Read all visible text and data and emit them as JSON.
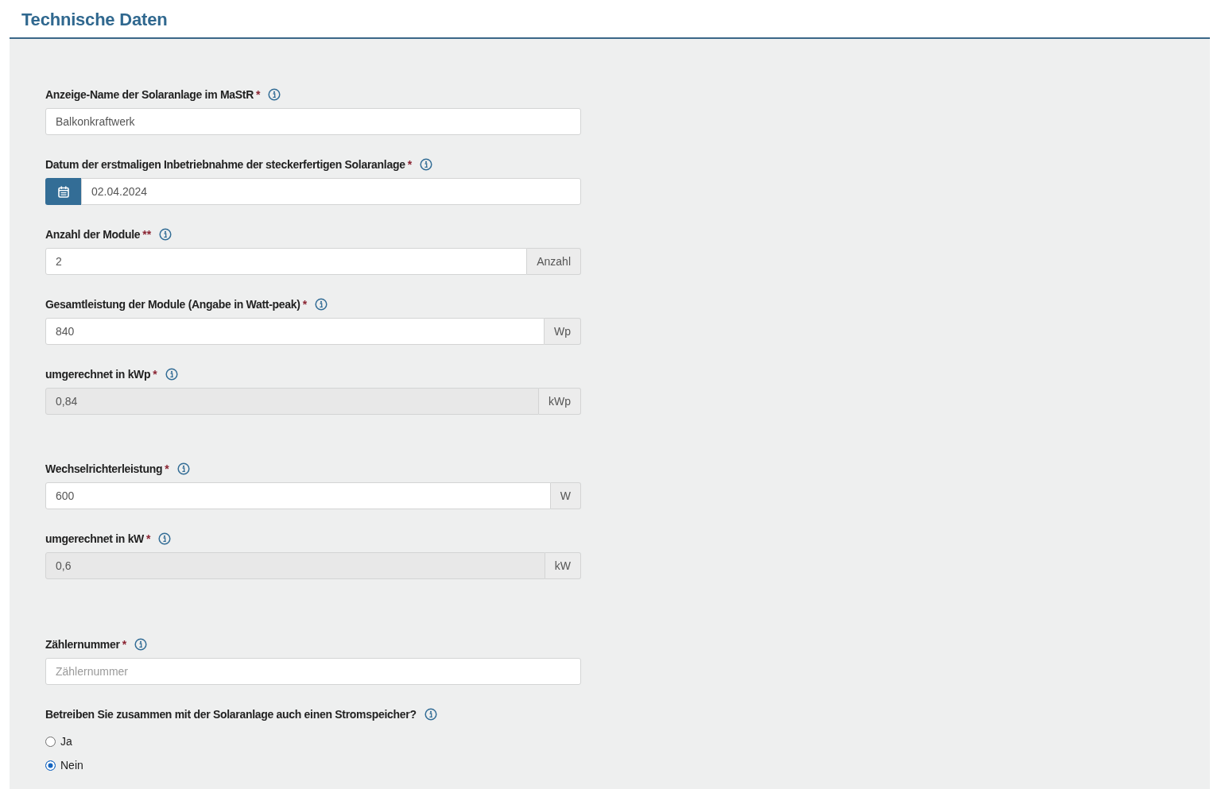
{
  "title": "Technische Daten",
  "sections": [
    {
      "fields": [
        {
          "kind": "text",
          "label": "Anzeige-Name der Solaranlage im MaStR",
          "required_mark": "*",
          "value": "Balkonkraftwerk",
          "disabled": false
        },
        {
          "kind": "date",
          "label": "Datum der erstmaligen Inbetriebnahme der steckerfertigen Solaranlage",
          "required_mark": "*",
          "value": "02.04.2024",
          "disabled": false
        },
        {
          "kind": "unit",
          "label": "Anzahl der Module",
          "required_mark": "**",
          "value": "2",
          "unit": "Anzahl",
          "disabled": false
        },
        {
          "kind": "unit",
          "label": "Gesamtleistung der Module (Angabe in Watt-peak)",
          "required_mark": "*",
          "value": "840",
          "unit": "Wp",
          "disabled": false
        },
        {
          "kind": "unit",
          "label": "umgerechnet in kWp",
          "required_mark": "*",
          "value": "0,84",
          "unit": "kWp",
          "disabled": true
        }
      ]
    },
    {
      "fields": [
        {
          "kind": "unit",
          "label": "Wechselrichterleistung",
          "required_mark": "*",
          "value": "600",
          "unit": "W",
          "disabled": false
        },
        {
          "kind": "unit",
          "label": "umgerechnet in kW",
          "required_mark": "*",
          "value": "0,6",
          "unit": "kW",
          "disabled": true
        }
      ]
    },
    {
      "fields": [
        {
          "kind": "text",
          "label": "Zählernummer",
          "required_mark": "*",
          "placeholder": "Zählernummer",
          "disabled": false
        },
        {
          "kind": "radio",
          "label": "Betreiben Sie zusammen mit der Solaranlage auch einen Stromspeicher?",
          "disabled": false,
          "options": [
            {
              "label": "Ja",
              "selected": false
            },
            {
              "label": "Nein",
              "selected": true
            }
          ]
        }
      ]
    }
  ]
}
